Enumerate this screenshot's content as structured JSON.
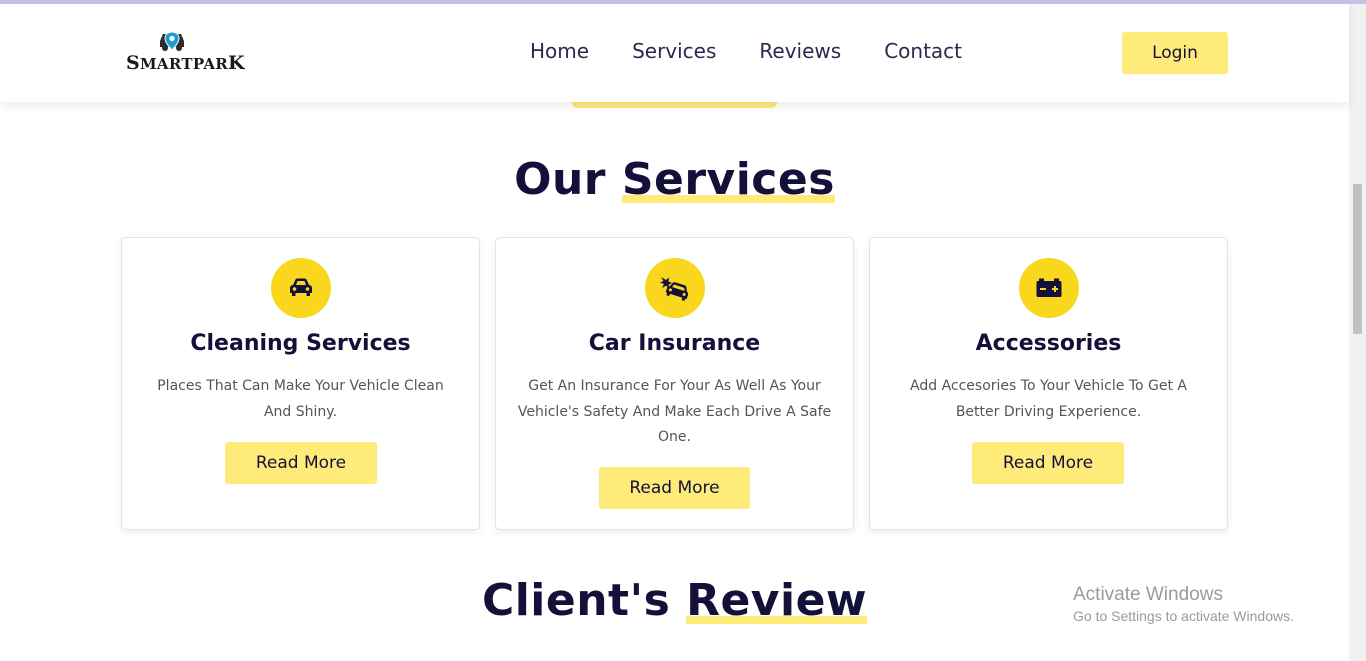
{
  "brand": {
    "logo_text_first": "S",
    "logo_text_rest": "MARTPAR",
    "logo_text_last": "K"
  },
  "nav": {
    "items": [
      "Home",
      "Services",
      "Reviews",
      "Contact"
    ],
    "login_label": "Login"
  },
  "services_section": {
    "title_part1": "Our ",
    "title_part2": "Services",
    "cards": [
      {
        "icon": "car-icon",
        "title": "Cleaning Services",
        "description": "Places That Can Make Your Vehicle Clean And Shiny.",
        "button": "Read More"
      },
      {
        "icon": "car-crash-icon",
        "title": "Car Insurance",
        "description": "Get An Insurance For Your As Well As Your Vehicle's Safety And Make Each Drive A Safe One.",
        "button": "Read More"
      },
      {
        "icon": "car-battery-icon",
        "title": "Accessories",
        "description": "Add Accesories To Your Vehicle To Get A Better Driving Experience.",
        "button": "Read More"
      }
    ]
  },
  "review_section": {
    "title_part1": "Client's ",
    "title_part2": "Review"
  },
  "watermark": {
    "title": "Activate Windows",
    "subtitle": "Go to Settings to activate Windows."
  },
  "colors": {
    "accent": "#ffeb7a",
    "icon_bg": "#f9d71c",
    "text_dark": "#13113a"
  }
}
